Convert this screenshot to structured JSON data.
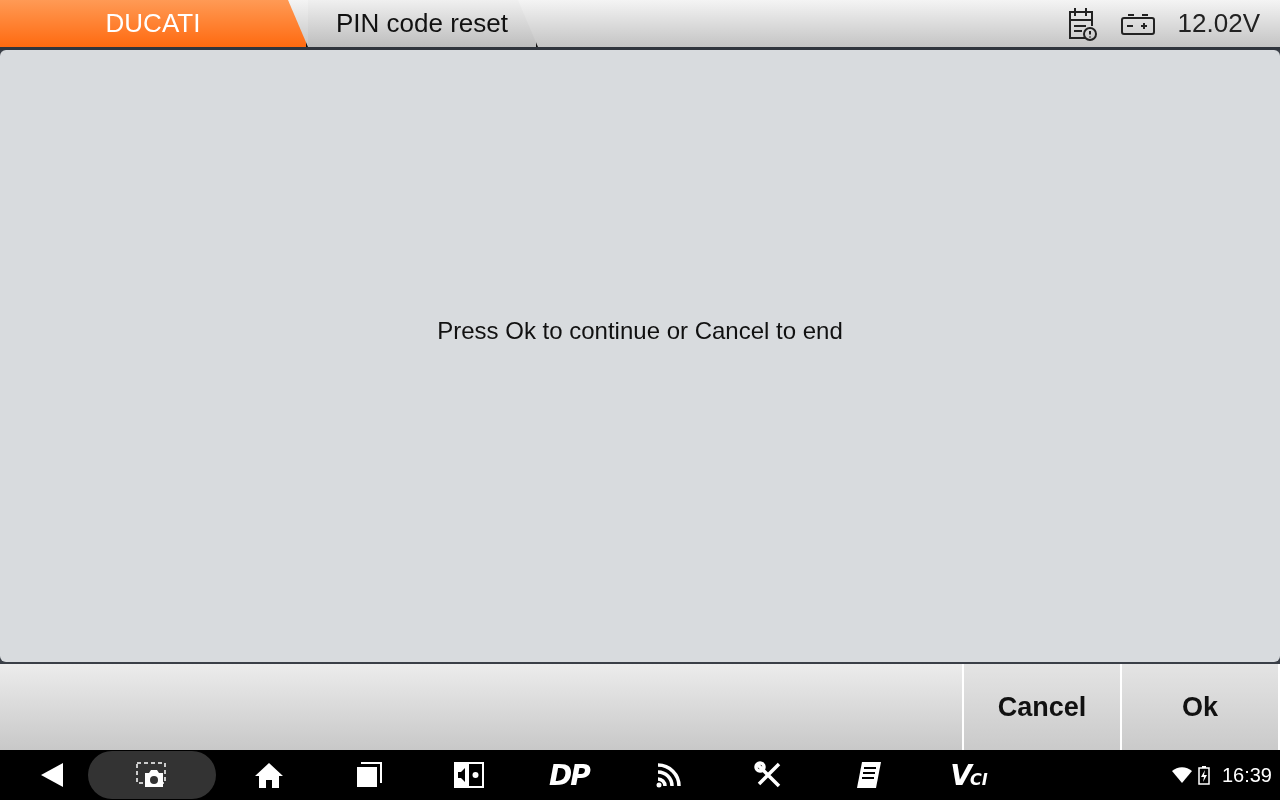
{
  "breadcrumbs": [
    {
      "label": "DUCATI",
      "selected": true
    },
    {
      "label": "PIN code reset",
      "selected": false
    }
  ],
  "status": {
    "voltage": "12.02V"
  },
  "message": "Press Ok to continue or Cancel to end",
  "buttons": [
    "Cancel",
    "Ok"
  ],
  "navbar": {
    "items": [
      {
        "kind": "back"
      },
      {
        "kind": "screenshot",
        "selected": true
      },
      {
        "kind": "home",
        "selected": false
      },
      {
        "kind": "recent",
        "selected": false
      },
      {
        "kind": "brightness",
        "selected": false
      },
      {
        "kind": "text",
        "label": "DP",
        "selected": false
      },
      {
        "kind": "wifi-signal",
        "selected": false
      },
      {
        "kind": "tools",
        "selected": false
      },
      {
        "kind": "manual",
        "selected": false
      },
      {
        "kind": "vci",
        "label": "V",
        "sub": "CI",
        "selected": false
      }
    ],
    "time": "16:39"
  }
}
